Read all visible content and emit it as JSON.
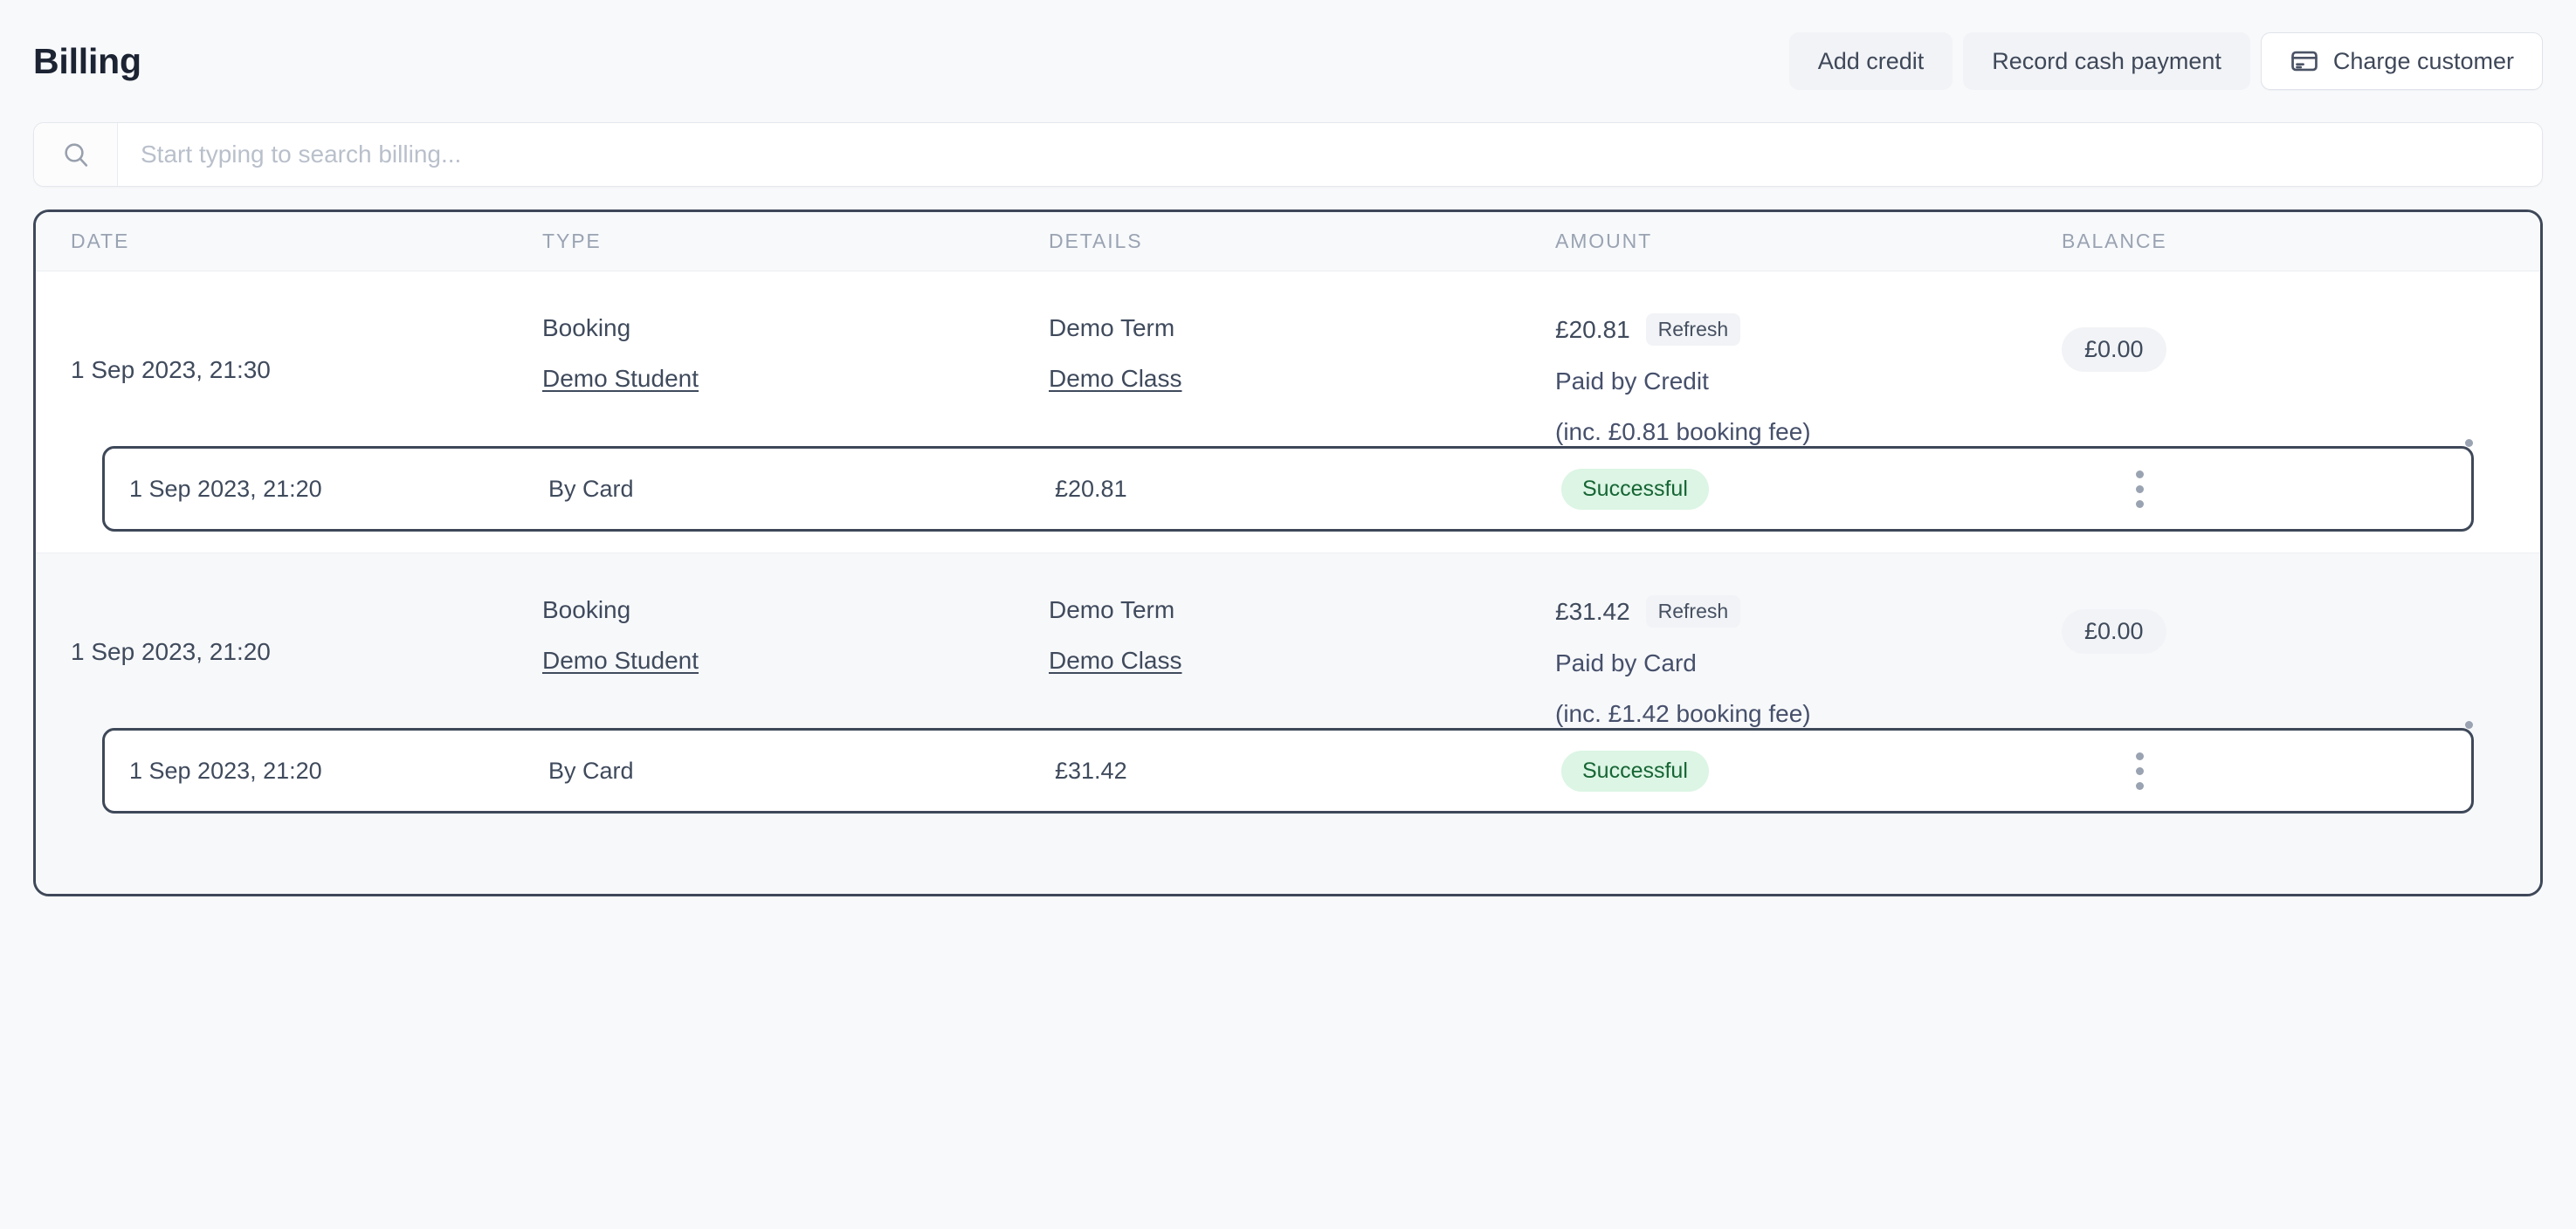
{
  "header": {
    "title": "Billing",
    "buttons": [
      {
        "label": "Add credit",
        "style": "plain",
        "icon": null
      },
      {
        "label": "Record cash payment",
        "style": "plain",
        "icon": null
      },
      {
        "label": "Charge customer",
        "style": "outline",
        "icon": "credit-card-icon"
      }
    ]
  },
  "search": {
    "icon": "search-icon",
    "placeholder": "Start typing to search billing...",
    "value": ""
  },
  "table": {
    "columns": [
      "DATE",
      "TYPE",
      "DETAILS",
      "AMOUNT",
      "BALANCE"
    ],
    "rows": [
      {
        "date": "1 Sep 2023, 21:30",
        "type": "Booking",
        "type_link": "Demo Student",
        "details": "Demo Term",
        "details_link": "Demo Class",
        "amount": "£20.81",
        "refresh_label": "Refresh",
        "paid_by": "Paid by Credit",
        "fee_note": "(inc. £0.81 booking fee)",
        "balance": "£0.00",
        "menu_icon": "kebab-menu-icon",
        "transaction": {
          "date": "1 Sep 2023, 21:20",
          "method": "By Card",
          "amount": "£20.81",
          "status": "Successful",
          "menu_icon": "kebab-menu-icon"
        }
      },
      {
        "date": "1 Sep 2023, 21:20",
        "type": "Booking",
        "type_link": "Demo Student",
        "details": "Demo Term",
        "details_link": "Demo Class",
        "amount": "£31.42",
        "refresh_label": "Refresh",
        "paid_by": "Paid by Card",
        "fee_note": "(inc. £1.42 booking fee)",
        "balance": "£0.00",
        "menu_icon": "kebab-menu-icon",
        "transaction": {
          "date": "1 Sep 2023, 21:20",
          "method": "By Card",
          "amount": "£31.42",
          "status": "Successful",
          "menu_icon": "kebab-menu-icon"
        }
      }
    ]
  },
  "colors": {
    "page_bg": "#f8f9fb",
    "border_dark": "#3e4859",
    "text": "#3f4a5c",
    "title": "#1c2433",
    "muted": "#9aa3b2",
    "success_bg": "#dcf5e4",
    "success_text": "#166534",
    "pill_bg": "#f1f3f6"
  }
}
